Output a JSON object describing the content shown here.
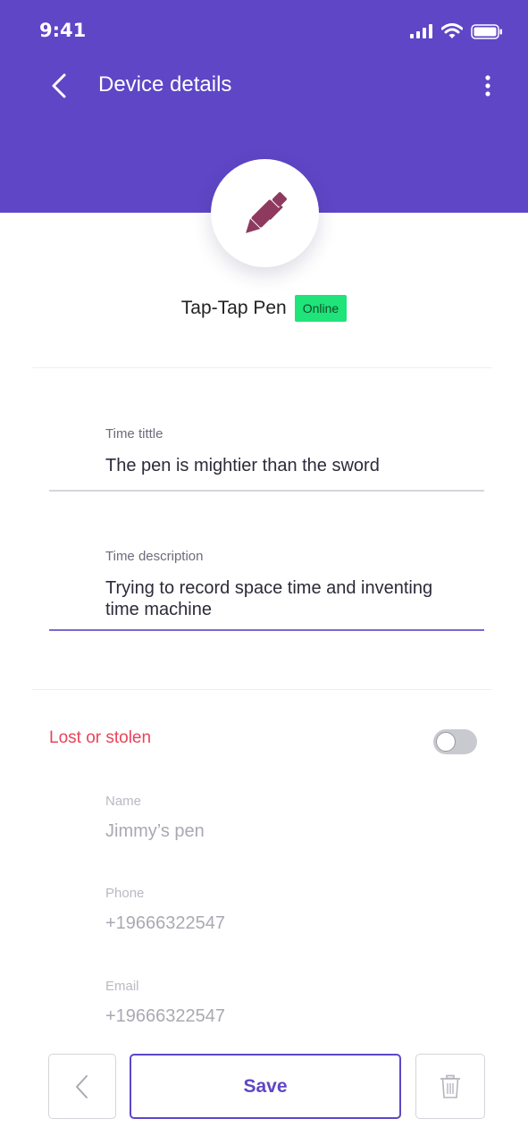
{
  "status_bar": {
    "time": "9:41",
    "icons": [
      "signal-icon",
      "wifi-icon",
      "battery-icon"
    ]
  },
  "header": {
    "title": "Device details",
    "back_icon": "chevron-left-icon",
    "menu_icon": "more-vertical-icon",
    "background_color": "#5f46c6"
  },
  "device": {
    "icon": "pen-icon",
    "icon_color": "#8e3a5e",
    "name": "Tap-Tap Pen",
    "status": "Online",
    "status_color": "#1fe47a"
  },
  "form": {
    "time_title": {
      "label": "Time tittle",
      "value": "The pen is mightier than the sword"
    },
    "time_description": {
      "label": "Time description",
      "value_line1": "Trying to record space time and inventing",
      "value_line2": "time machine"
    }
  },
  "lost_section": {
    "label": "Lost or stolen",
    "label_color": "#e9445a",
    "enabled": false,
    "name": {
      "label": "Name",
      "value": "Jimmy’s pen"
    },
    "phone": {
      "label": "Phone",
      "value": "+19666322547"
    },
    "email": {
      "label": "Email",
      "value": "+19666322547"
    }
  },
  "footer": {
    "back_icon": "chevron-left-icon",
    "save_label": "Save",
    "delete_icon": "trash-icon"
  },
  "accent_color": "#5f46c6"
}
